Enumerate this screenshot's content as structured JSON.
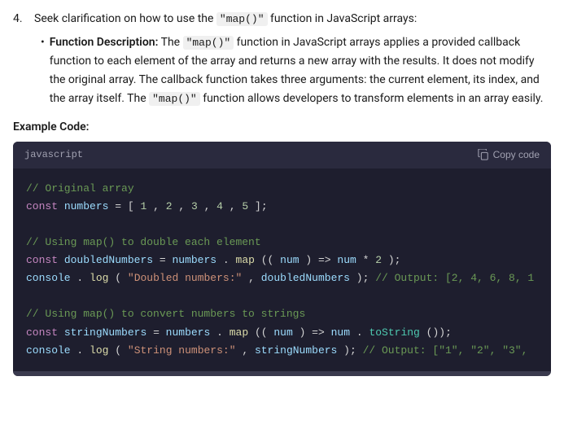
{
  "item": {
    "number": "4.",
    "text_before": "Seek clarification on how to use the ",
    "code1": "\"map()\"",
    "text_after": " function in JavaScript arrays:"
  },
  "bullet": {
    "marker": "•",
    "label": "Function Description:",
    "description_parts": [
      "The ",
      "\"map()\"",
      " function in JavaScript arrays applies a provided callback function to each element of the array and returns a new array with the results. It does not modify the original array. The callback function takes three arguments: the current element, its index, and the array itself. The ",
      "\"map()\"",
      " function allows developers to transform elements in an array easily."
    ]
  },
  "example_label": "Example Code:",
  "code_block": {
    "lang": "javascript",
    "copy_label": "Copy code",
    "lines": [
      {
        "type": "comment",
        "text": "// Original array"
      },
      {
        "type": "code",
        "text": "const numbers = [1, 2, 3, 4, 5];"
      },
      {
        "type": "empty"
      },
      {
        "type": "comment",
        "text": "// Using map() to double each element"
      },
      {
        "type": "code",
        "text": "const doubledNumbers = numbers.map((num) => num * 2);"
      },
      {
        "type": "code",
        "text": "console.log(\"Doubled numbers:\", doubledNumbers); // Output: [2, 4, 6, 8, 1"
      },
      {
        "type": "empty"
      },
      {
        "type": "comment",
        "text": "// Using map() to convert numbers to strings"
      },
      {
        "type": "code",
        "text": "const stringNumbers = numbers.map((num) => num.toString());"
      },
      {
        "type": "code",
        "text": "console.log(\"String numbers:\", stringNumbers); // Output: [\"1\", \"2\", \"3\","
      }
    ]
  }
}
